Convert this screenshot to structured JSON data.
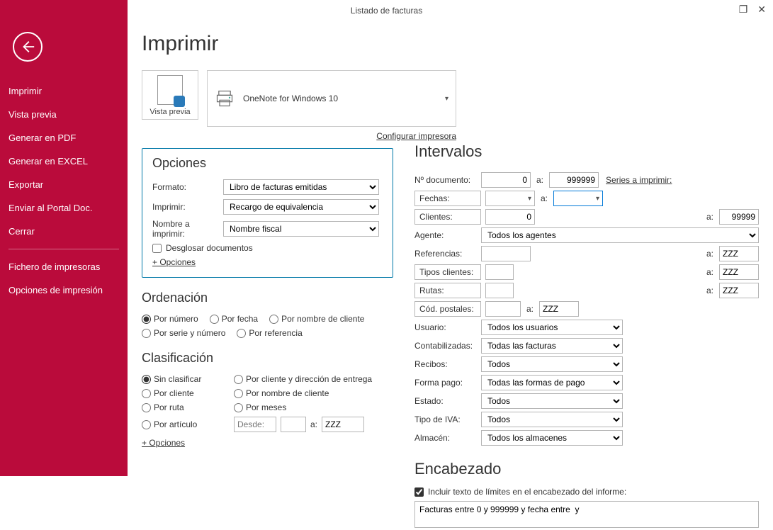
{
  "window": {
    "title": "Listado de facturas"
  },
  "sidebar": {
    "items": [
      "Imprimir",
      "Vista previa",
      "Generar en PDF",
      "Generar en EXCEL",
      "Exportar",
      "Enviar al Portal Doc.",
      "Cerrar"
    ],
    "lower": [
      "Fichero de impresoras",
      "Opciones de impresión"
    ]
  },
  "page": {
    "title": "Imprimir",
    "preview_label": "Vista previa",
    "printer_name": "OneNote for Windows 10",
    "configure_link": "Configurar impresora"
  },
  "opciones": {
    "title": "Opciones",
    "formato_label": "Formato:",
    "formato_value": "Libro de facturas emitidas",
    "imprimir_label": "Imprimir:",
    "imprimir_value": "Recargo de equivalencia",
    "nombre_label": "Nombre a imprimir:",
    "nombre_value": "Nombre fiscal",
    "desglosar": "Desglosar documentos",
    "plus": "+ Opciones"
  },
  "ordenacion": {
    "title": "Ordenación",
    "r1": "Por número",
    "r2": "Por fecha",
    "r3": "Por nombre de cliente",
    "r4": "Por serie y número",
    "r5": "Por referencia"
  },
  "clasificacion": {
    "title": "Clasificación",
    "r1": "Sin clasificar",
    "r2": "Por cliente y dirección de entrega",
    "r3": "Por cliente",
    "r4": "Por nombre de cliente",
    "r5": "Por ruta",
    "r6": "Por meses",
    "r7": "Por artículo",
    "desde_ph": "Desde:",
    "a_label": "a:",
    "a_value": "ZZZ",
    "plus": "+ Opciones"
  },
  "intervalos": {
    "title": "Intervalos",
    "ndoc_label": "Nº documento:",
    "ndoc_from": "0",
    "ndoc_to": "999999",
    "a": "a:",
    "series_link": "Series a imprimir:",
    "fechas_label": "Fechas:",
    "clientes_label": "Clientes:",
    "clientes_from": "0",
    "clientes_to": "99999",
    "agente_label": "Agente:",
    "agente_value": "Todos los agentes",
    "ref_label": "Referencias:",
    "ref_to": "ZZZ",
    "tipos_label": "Tipos clientes:",
    "tipos_to": "ZZZ",
    "rutas_label": "Rutas:",
    "rutas_to": "ZZZ",
    "cp_label": "Cód. postales:",
    "cp_to": "ZZZ",
    "usuario_label": "Usuario:",
    "usuario_value": "Todos los usuarios",
    "contab_label": "Contabilizadas:",
    "contab_value": "Todas las facturas",
    "recibos_label": "Recibos:",
    "recibos_value": "Todos",
    "fpago_label": "Forma pago:",
    "fpago_value": "Todas las formas de pago",
    "estado_label": "Estado:",
    "estado_value": "Todos",
    "tiva_label": "Tipo de IVA:",
    "tiva_value": "Todos",
    "almacen_label": "Almacén:",
    "almacen_value": "Todos los almacenes"
  },
  "encabezado": {
    "title": "Encabezado",
    "check_label": "Incluir texto de límites en el encabezado del informe:",
    "text": "Facturas entre 0 y 999999 y fecha entre  y"
  }
}
